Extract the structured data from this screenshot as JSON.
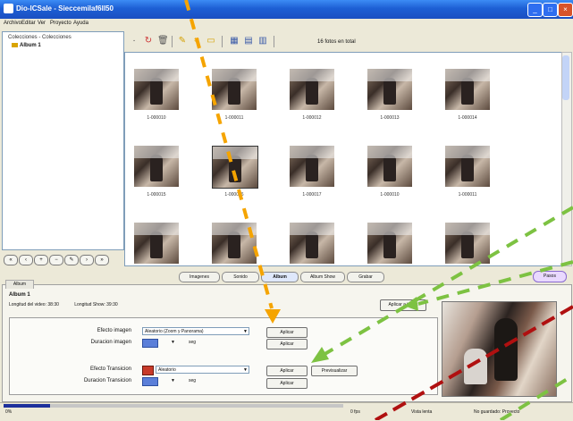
{
  "window": {
    "title": "Dio-lCSale - Sieccemilaf6ll50"
  },
  "menu": [
    "Archivo",
    "Editar",
    "Ver",
    "Proyecto",
    "Ayuda"
  ],
  "tree": {
    "root": "Colecciones - Colecciones",
    "album": "Album 1"
  },
  "toolbar": {
    "photo_count": "16 fotos en total"
  },
  "thumbnails": [
    "1-000010",
    "1-000011",
    "1-000012",
    "1-000013",
    "1-000014",
    "1-000015",
    "1-000016",
    "1-000017"
  ],
  "tabs": [
    "Imagenes",
    "Sonido",
    "Album",
    "Album Show",
    "Grabar"
  ],
  "active_tab": "Album",
  "right_pill": "Pasos",
  "section_tab": "Album",
  "album": {
    "header": "Album 1",
    "length_video": "Longitud del video: 38:30",
    "length_show": "Longitud Show: 39:30",
    "auto_button": "Aplicar a todos"
  },
  "settings": {
    "effect_images_label": "Efecto imagen",
    "effect_images_value": "Aleatorio (Zoom y Panorama)",
    "duration_images_label": "Duracion imagen",
    "unit": "seg",
    "effect_transition_label": "Efecto Transicion",
    "effect_transition_value": "Aleatorio",
    "duration_transition_label": "Duracion Transicion",
    "apply_label": "Aplicar",
    "preview_label": "Previsualizar"
  },
  "status": {
    "left": "0%",
    "mid": "0 fps",
    "speed_label": "Vista lenta",
    "right": "No guardado: Proyecto"
  },
  "colors": {
    "title_bar": "#1d5fd4",
    "arrow_orange": "#f5a400",
    "arrow_green": "#7dc242",
    "arrow_red": "#b01010"
  }
}
